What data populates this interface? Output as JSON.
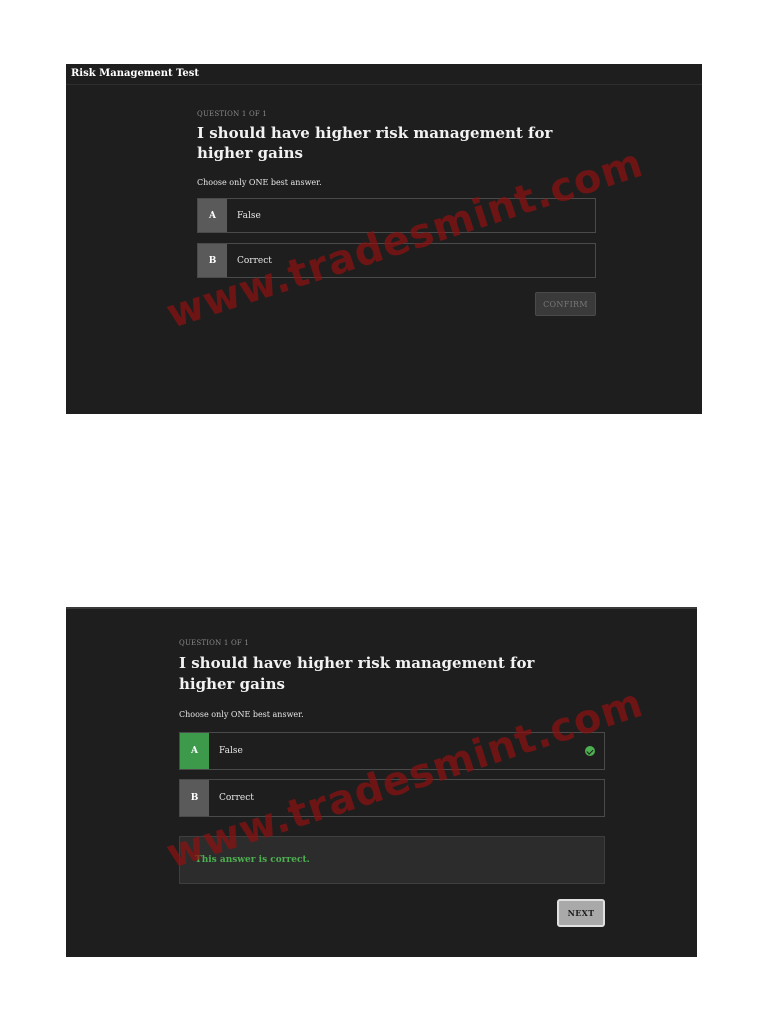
{
  "window_title": "Risk Management Test",
  "screen1": {
    "question_number": "QUESTION 1 OF 1",
    "question": "I should have higher risk management for higher gains",
    "instruction": "Choose only ONE best answer.",
    "options": [
      {
        "letter": "A",
        "label": "False"
      },
      {
        "letter": "B",
        "label": "Correct"
      }
    ],
    "confirm_label": "CONFIRM"
  },
  "screen2": {
    "question_number": "QUESTION 1 OF 1",
    "question": "I should have higher risk management for higher gains",
    "instruction": "Choose only ONE best answer.",
    "options": [
      {
        "letter": "A",
        "label": "False",
        "selected": true,
        "status": "correct"
      },
      {
        "letter": "B",
        "label": "Correct"
      }
    ],
    "feedback": "This answer is correct.",
    "next_label": "NEXT"
  },
  "watermark": "www.tradesmint.com",
  "colors": {
    "panel_bg": "#1e1e1e",
    "correct_green": "#3c9a4a",
    "watermark_red": "#8c1212"
  }
}
